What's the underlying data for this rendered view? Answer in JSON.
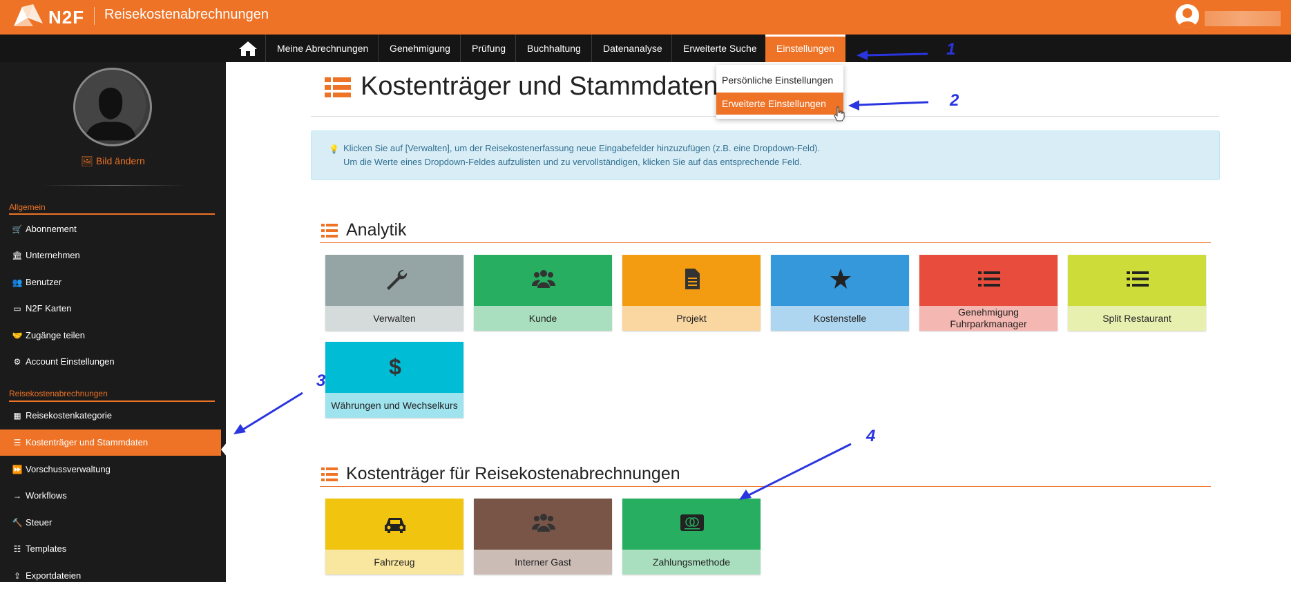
{
  "header": {
    "brand": "N2F",
    "app_title": "Reisekostenabrechnungen"
  },
  "nav": {
    "items": [
      {
        "label": "Meine Abrechnungen"
      },
      {
        "label": "Genehmigung"
      },
      {
        "label": "Prüfung"
      },
      {
        "label": "Buchhaltung"
      },
      {
        "label": "Datenanalyse"
      },
      {
        "label": "Erweiterte Suche"
      },
      {
        "label": "Einstellungen"
      }
    ],
    "dropdown": [
      {
        "label": "Persönliche Einstellungen"
      },
      {
        "label": "Erweiterte Einstellungen"
      }
    ]
  },
  "sidebar": {
    "change_picture": "Bild ändern",
    "section_general": "Allgemein",
    "general_items": [
      {
        "label": "Abonnement",
        "icon": "cart-icon"
      },
      {
        "label": "Unternehmen",
        "icon": "bank-icon"
      },
      {
        "label": "Benutzer",
        "icon": "users-icon"
      },
      {
        "label": "N2F Karten",
        "icon": "card-icon"
      },
      {
        "label": "Zugänge teilen",
        "icon": "handshake-icon"
      },
      {
        "label": "Account Einstellungen",
        "icon": "gears-icon"
      }
    ],
    "section_expenses": "Reisekostenabrechnungen",
    "expense_items": [
      {
        "label": "Reisekostenkategorie",
        "icon": "grid-icon"
      },
      {
        "label": "Kostenträger und Stammdaten",
        "icon": "list-icon"
      },
      {
        "label": "Vorschussverwaltung",
        "icon": "fast-forward-icon"
      },
      {
        "label": "Workflows",
        "icon": "arrow-right-icon"
      },
      {
        "label": "Steuer",
        "icon": "gavel-icon"
      },
      {
        "label": "Templates",
        "icon": "list-alt-icon"
      },
      {
        "label": "Exportdateien",
        "icon": "export-icon"
      }
    ]
  },
  "main": {
    "title": "Kostenträger und Stammdaten",
    "info_line1": "Klicken Sie auf [Verwalten], um der Reisekostenerfassung neue Eingabefelder hinzuzufügen (z.B. eine Dropdown-Feld).",
    "info_line2": "Um die Werte eines Dropdown-Feldes aufzulisten und zu vervollständigen, klicken Sie auf das entsprechende Feld.",
    "analytics_title": "Analytik",
    "analytics_tiles": [
      {
        "label": "Verwalten",
        "icon": "wrench-icon",
        "top": "#95a5a6",
        "bottom": "#d5dbdb"
      },
      {
        "label": "Kunde",
        "icon": "users-icon",
        "top": "#27ae60",
        "bottom": "#a9dfbf"
      },
      {
        "label": "Projekt",
        "icon": "document-icon",
        "top": "#f39c12",
        "bottom": "#fad7a0"
      },
      {
        "label": "Kostenstelle",
        "icon": "star-icon",
        "top": "#3498db",
        "bottom": "#aed6f1"
      },
      {
        "label": "Genehmigung Fuhrparkmanager",
        "icon": "list-icon",
        "top": "#e74c3c",
        "bottom": "#f5b7b1"
      },
      {
        "label": "Split Restaurant",
        "icon": "list-icon",
        "top": "#cddc39",
        "bottom": "#e8f0b0"
      },
      {
        "label": "Währungen und Wechselkurs",
        "icon": "dollar-icon",
        "top": "#00bcd4",
        "bottom": "#9fe3ee"
      }
    ],
    "cost_title": "Kostenträger für Reisekostenabrechnungen",
    "cost_tiles": [
      {
        "label": "Fahrzeug",
        "icon": "car-icon",
        "top": "#f1c40f",
        "bottom": "#f9e79f"
      },
      {
        "label": "Interner Gast",
        "icon": "users-icon",
        "top": "#795548",
        "bottom": "#cbbcb6"
      },
      {
        "label": "Zahlungsmethode",
        "icon": "payment-card-icon",
        "top": "#27ae60",
        "bottom": "#a9dfbf"
      }
    ]
  },
  "annotations": [
    "1",
    "2",
    "3",
    "4"
  ],
  "colors": {
    "accent": "#ee7326",
    "navbar": "#151515",
    "sidebar": "#1b1b1b",
    "annotation": "#2a35e0"
  }
}
